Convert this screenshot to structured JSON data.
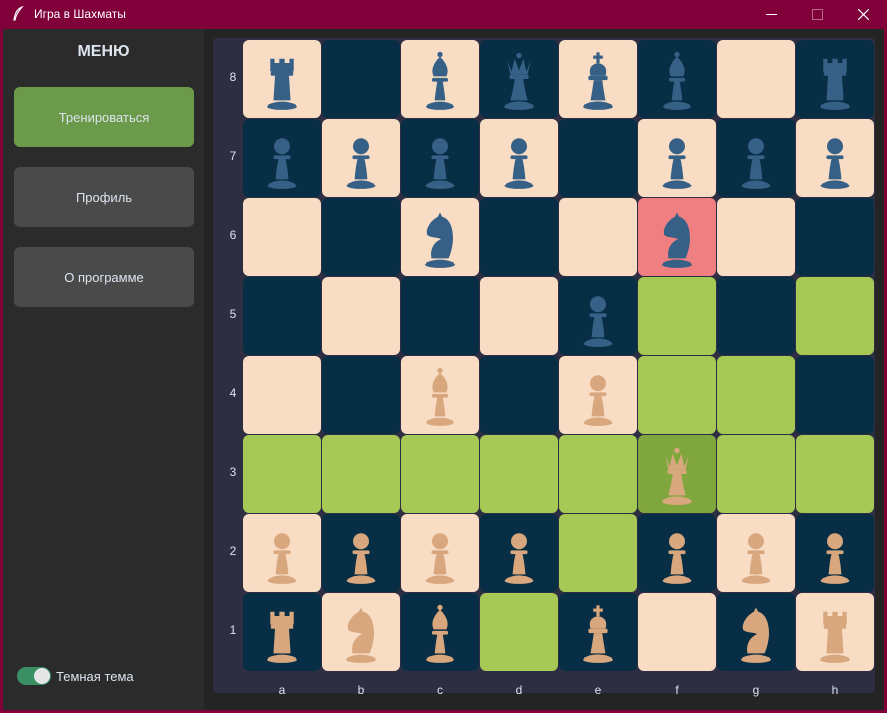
{
  "window": {
    "title": "Игра в Шахматы",
    "icon": "feather-icon",
    "controls": [
      "minimize-icon",
      "maximize-icon",
      "close-icon"
    ]
  },
  "sidebar": {
    "menu_title": "МЕНЮ",
    "buttons": {
      "train": "Тренироваться",
      "profile": "Профиль",
      "about": "О программе"
    },
    "theme_toggle": {
      "label": "Темная тема",
      "on": true
    }
  },
  "board": {
    "files": [
      "a",
      "b",
      "c",
      "d",
      "e",
      "f",
      "g",
      "h"
    ],
    "ranks": [
      "8",
      "7",
      "6",
      "5",
      "4",
      "3",
      "2",
      "1"
    ],
    "colors": {
      "light": "#f8dcc4",
      "dark": "#082e45",
      "move_hint": "#a6c956",
      "selected": "#80a73e",
      "threat": "#ef7f80",
      "white_piece": "#d8a77e",
      "black_piece": "#376086"
    },
    "pieces": {
      "a8": "black-rook",
      "c8": "black-bishop",
      "d8": "black-queen",
      "e8": "black-king",
      "f8": "black-bishop",
      "h8": "black-rook",
      "a7": "black-pawn",
      "b7": "black-pawn",
      "c7": "black-pawn",
      "d7": "black-pawn",
      "f7": "black-pawn",
      "g7": "black-pawn",
      "h7": "black-pawn",
      "c6": "black-knight",
      "f6": "black-knight",
      "e5": "black-pawn",
      "c4": "white-bishop",
      "e4": "white-pawn",
      "f3": "white-queen",
      "a2": "white-pawn",
      "b2": "white-pawn",
      "c2": "white-pawn",
      "d2": "white-pawn",
      "f2": "white-pawn",
      "g2": "white-pawn",
      "h2": "white-pawn",
      "a1": "white-rook",
      "b1": "white-knight",
      "c1": "white-bishop",
      "e1": "white-king",
      "g1": "white-knight",
      "h1": "white-rook"
    },
    "selected_square": "f3",
    "threatened_squares": [
      "f6"
    ],
    "move_hint_squares": [
      "f5",
      "h5",
      "f4",
      "g4",
      "a3",
      "b3",
      "c3",
      "d3",
      "e3",
      "g3",
      "h3",
      "e2",
      "d1"
    ]
  }
}
